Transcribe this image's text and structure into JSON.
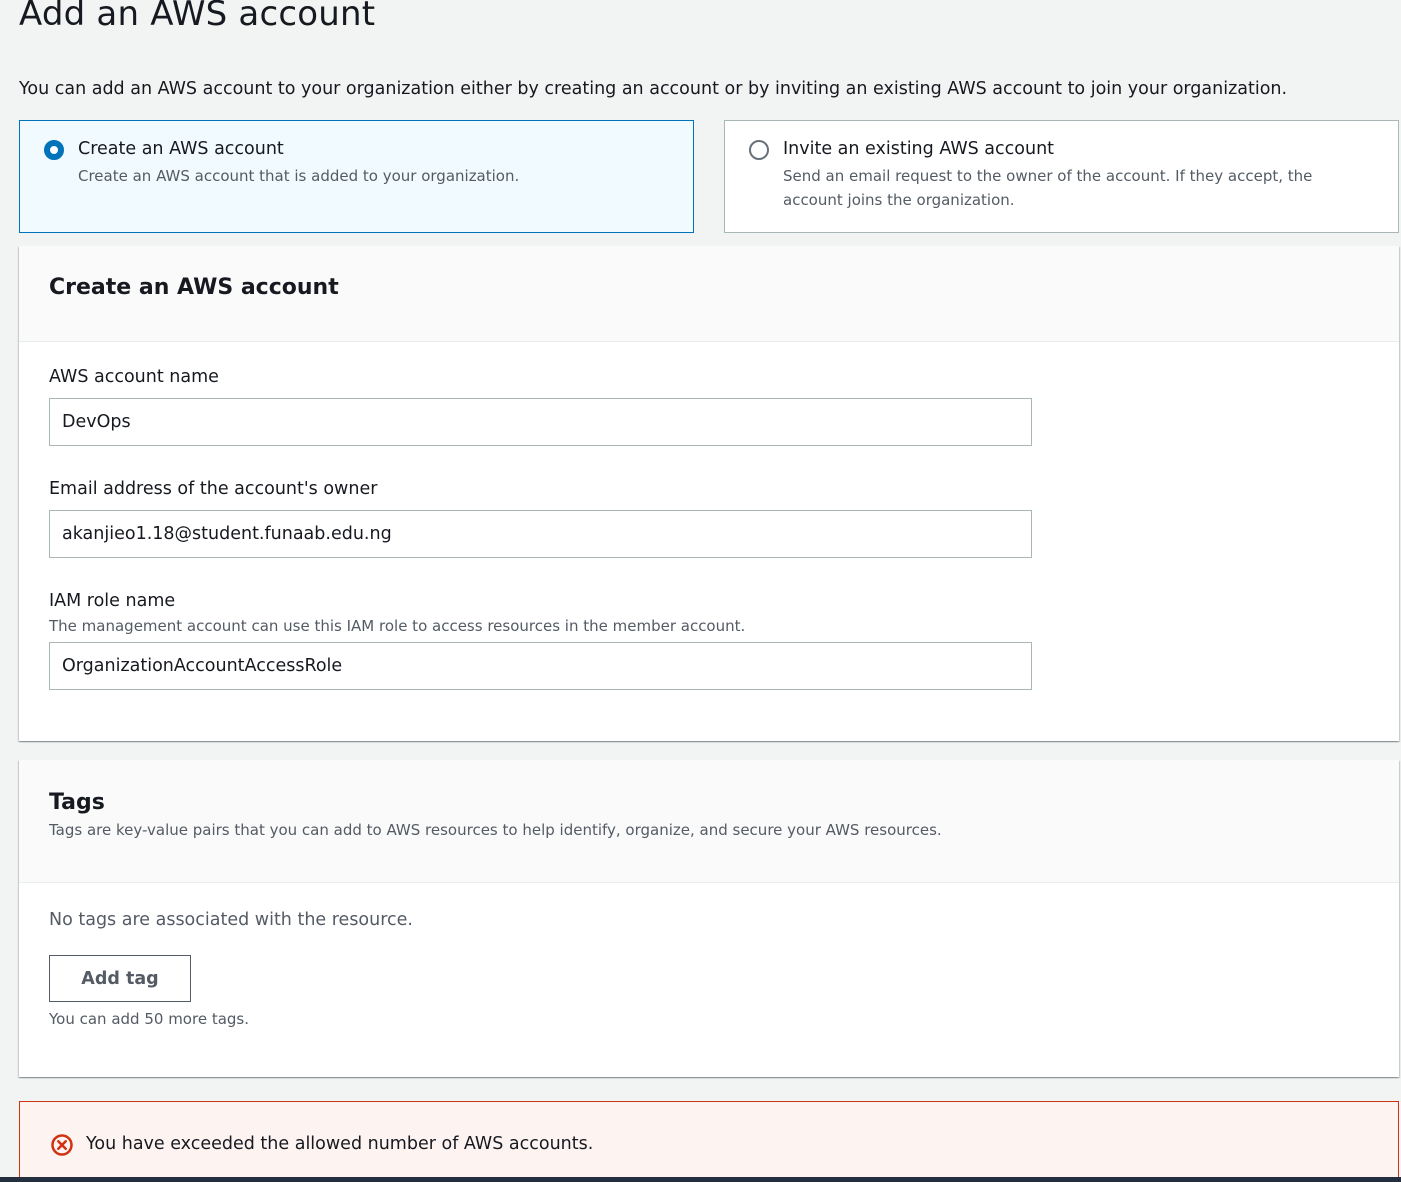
{
  "page": {
    "title": "Add an AWS account",
    "intro": "You can add an AWS account to your organization either by creating an account or by inviting an existing AWS account to join your organization."
  },
  "options": [
    {
      "label": "Create an AWS account",
      "description": "Create an AWS account that is added to your organization.",
      "selected": true
    },
    {
      "label": "Invite an existing AWS account",
      "description": "Send an email request to the owner of the account. If they accept, the account joins the organization.",
      "selected": false
    }
  ],
  "create_section": {
    "title": "Create an AWS account",
    "account_name": {
      "label": "AWS account name",
      "value": "DevOps"
    },
    "email": {
      "label": "Email address of the account's owner",
      "value": "akanjieo1.18@student.funaab.edu.ng"
    },
    "role": {
      "label": "IAM role name",
      "description": "The management account can use this IAM role to access resources in the member account.",
      "value": "OrganizationAccountAccessRole"
    }
  },
  "tags_section": {
    "title": "Tags",
    "description": "Tags are key-value pairs that you can add to AWS resources to help identify, organize, and secure your AWS resources.",
    "empty_text": "No tags are associated with the resource.",
    "add_button": "Add tag",
    "hint": "You can add 50 more tags."
  },
  "alert": {
    "text": "You have exceeded the allowed number of AWS accounts.",
    "icon": "error-circle-x-icon",
    "color": "#d13212"
  },
  "colors": {
    "primary": "#0073bb",
    "error": "#d13212",
    "background": "#f2f3f3"
  }
}
